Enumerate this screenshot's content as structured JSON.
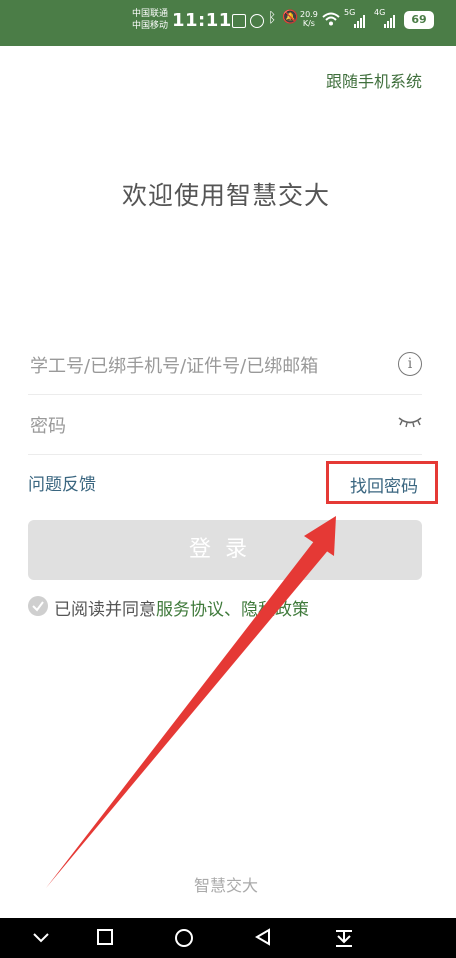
{
  "status_bar": {
    "carrier_1": "中国联通",
    "carrier_2": "中国移动",
    "time": "11:11",
    "net_speed_value": "20.9",
    "net_speed_unit": "K/s",
    "network_1": "5G",
    "network_2": "4G",
    "battery": "69"
  },
  "header": {
    "follow_system_label": "跟随手机系统",
    "welcome_title": "欢迎使用智慧交大"
  },
  "form": {
    "username_placeholder": "学工号/已绑手机号/证件号/已绑邮箱",
    "password_placeholder": "密码",
    "feedback_label": "问题反馈",
    "forgot_password_label": "找回密码",
    "login_label": "登录",
    "agree_prefix": "已阅读并同意",
    "service_agreement": "服务协议",
    "separator": "、",
    "privacy_policy": "隐私政策"
  },
  "footer": {
    "brand": "智慧交大"
  },
  "colors": {
    "status_bar_bg": "#4b7d47",
    "link_green": "#3f6f3c",
    "link_blue": "#3a6680",
    "annotation_red": "#e53935"
  }
}
